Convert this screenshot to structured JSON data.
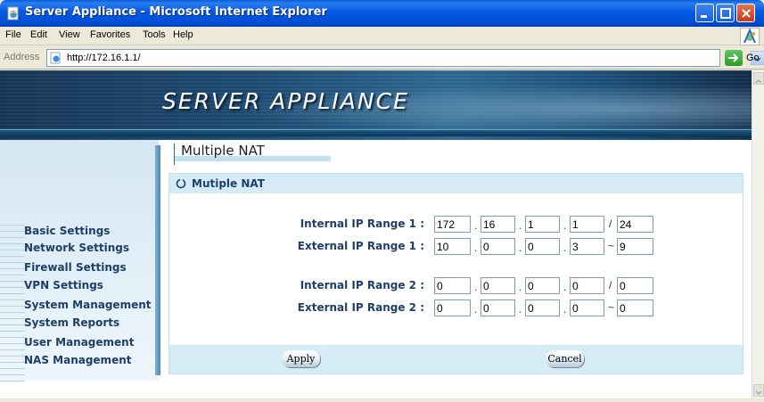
{
  "window": {
    "title": "Server Appliance - Microsoft Internet Explorer"
  },
  "menubar": {
    "items": [
      "File",
      "Edit",
      "View",
      "Favorites",
      "Tools",
      "Help"
    ]
  },
  "addressbar": {
    "label": "Address",
    "url": "http://172.16.1.1/",
    "go_label": "Go"
  },
  "banner": {
    "title": "SERVER APPLIANCE"
  },
  "sidebar": {
    "items": [
      {
        "label": "Basic Settings"
      },
      {
        "label": "Network Settings"
      },
      {
        "label": "Firewall Settings"
      },
      {
        "label": "VPN Settings"
      },
      {
        "label": "System Management"
      },
      {
        "label": "System Reports"
      },
      {
        "label": "User Management"
      },
      {
        "label": "NAS Management"
      }
    ]
  },
  "page": {
    "header_title": "Multiple NAT",
    "panel_title": "Mutiple NAT",
    "rows": [
      {
        "label": "Internal IP Range 1 :",
        "o1": "172",
        "o2": "16",
        "o3": "1",
        "o4": "1",
        "sep": "/",
        "last": "24"
      },
      {
        "label": "External IP Range 1 :",
        "o1": "10",
        "o2": "0",
        "o3": "0",
        "o4": "3",
        "sep": "~",
        "last": "9"
      },
      {
        "label": "Internal IP Range 2 :",
        "o1": "0",
        "o2": "0",
        "o3": "0",
        "o4": "0",
        "sep": "/",
        "last": "0"
      },
      {
        "label": "External IP Range 2 :",
        "o1": "0",
        "o2": "0",
        "o3": "0",
        "o4": "0",
        "sep": "~",
        "last": "0"
      }
    ],
    "dot": ".",
    "apply_label": "Apply",
    "cancel_label": "Cancel"
  },
  "colors": {
    "label_blue": "#1d3f68",
    "panel_bg": "#d5ecf7",
    "banner_dark": "#153454"
  },
  "icons": [
    "ie-page-icon",
    "ie-logo-icon",
    "go-arrow-icon",
    "refresh-circle-icon",
    "minimize-icon",
    "maximize-icon",
    "close-icon"
  ]
}
